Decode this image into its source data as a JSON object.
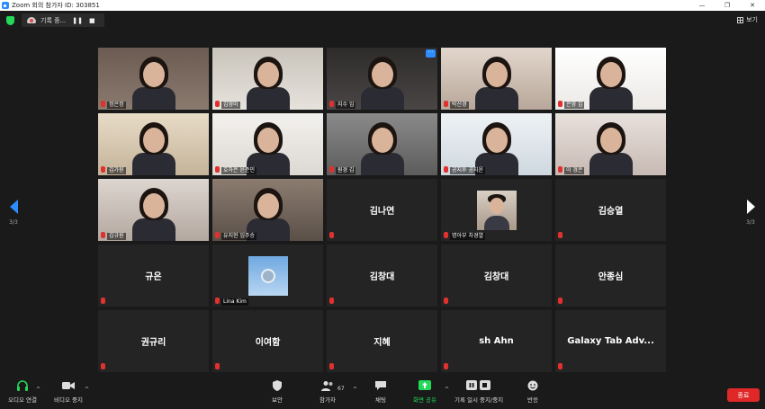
{
  "window": {
    "title": "Zoom 회의 참가자 ID: 303851",
    "minimize": "—",
    "maximize": "❐",
    "close": "✕"
  },
  "topbar": {
    "recording_label": "기록 중...",
    "pause_glyph": "❚❚",
    "stop_glyph": "■",
    "view_label": "보기"
  },
  "pager": {
    "left_page": "3/3",
    "right_page": "3/3"
  },
  "tiles": [
    {
      "name": "정은정",
      "kind": "video",
      "bg": "#8a7a6e",
      "top": "#6b5b52"
    },
    {
      "name": "김영미",
      "kind": "video",
      "bg": "#e6e2dc",
      "top": "#c9c4bb"
    },
    {
      "name": "지수 임",
      "kind": "video",
      "bg": "#4a4646",
      "top": "#2e2b2b"
    },
    {
      "name": "박선경",
      "kind": "video",
      "bg": "#b8a79a",
      "top": "#e2d6cc"
    },
    {
      "name": "은영 김",
      "kind": "video",
      "bg": "#ece9e6",
      "top": "#ffffff"
    },
    {
      "name": "김가원",
      "kind": "video",
      "bg": "#c4b39a",
      "top": "#e8dcc7"
    },
    {
      "name": "호하은 윤준민",
      "kind": "video",
      "bg": "#dcd8d2",
      "top": "#f3f1ee"
    },
    {
      "name": "원경 김",
      "kind": "video",
      "bg": "#5c5c5c",
      "top": "#8a8a8a"
    },
    {
      "name": "공지후 공지윤",
      "kind": "video",
      "bg": "#cfd8e0",
      "top": "#eef2f5"
    },
    {
      "name": "이 경은",
      "kind": "video",
      "bg": "#c7b9b3",
      "top": "#e9e1dc"
    },
    {
      "name": "김규원",
      "kind": "video",
      "bg": "#b3a8a0",
      "top": "#ddd5cf"
    },
    {
      "name": "유지현 임주승",
      "kind": "video",
      "bg": "#5a5048",
      "top": "#8c7c70"
    },
    {
      "name": "김나연",
      "kind": "name"
    },
    {
      "name": "명아부 차경열",
      "kind": "thumb"
    },
    {
      "name": "김승열",
      "kind": "name"
    },
    {
      "name": "규은",
      "kind": "name"
    },
    {
      "name": "Lina Kim",
      "kind": "sky"
    },
    {
      "name": "김창대",
      "kind": "name"
    },
    {
      "name": "김창대",
      "kind": "name"
    },
    {
      "name": "안종심",
      "kind": "name"
    },
    {
      "name": "권규리",
      "kind": "name"
    },
    {
      "name": "이여함",
      "kind": "name"
    },
    {
      "name": "지혜",
      "kind": "name"
    },
    {
      "name": "sh Ahn",
      "kind": "name"
    },
    {
      "name": "Galaxy Tab Adv...",
      "kind": "name"
    }
  ],
  "toolbar": {
    "audio": "오디오 연결",
    "video": "비디오 중지",
    "security": "보안",
    "participants": "참가자",
    "participants_count": "67",
    "chat": "채팅",
    "share": "화면 공유",
    "record": "기록 일시 중지/중지",
    "reactions": "반응",
    "end": "종료"
  },
  "colors": {
    "accent": "#2d8cff",
    "share_green": "#23d959",
    "end_red": "#e02828",
    "mic_red": "#e0312f"
  }
}
